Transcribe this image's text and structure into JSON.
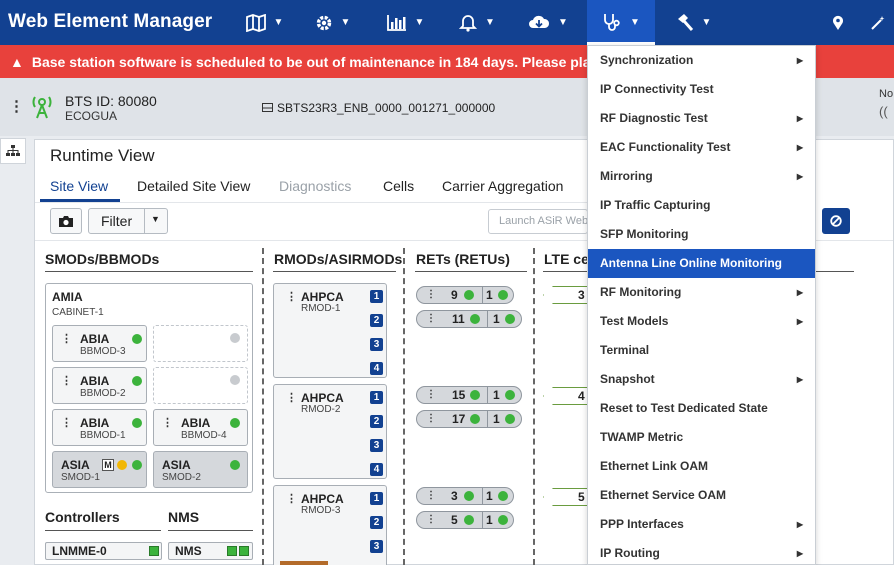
{
  "app": {
    "title": "Web Element Manager"
  },
  "nav": {
    "items": [
      {
        "icon": "map-icon"
      },
      {
        "icon": "gear-icon"
      },
      {
        "icon": "bar-chart-icon"
      },
      {
        "icon": "bell-icon"
      },
      {
        "icon": "cloud-download-icon"
      },
      {
        "icon": "stethoscope-icon"
      },
      {
        "icon": "hammer-icon"
      },
      {
        "icon": "location-pin-icon"
      },
      {
        "icon": "magic-wand-icon"
      }
    ]
  },
  "alert": {
    "text": "Base station software is scheduled to be out of maintenance in 184 days. Please plan to"
  },
  "bts": {
    "id": "BTS ID: 80080",
    "name": "ECOGUA",
    "software": "SBTS23R3_ENB_0000_001271_000000",
    "right_label": "No"
  },
  "runtime": {
    "title": "Runtime View",
    "tabs": [
      "Site View",
      "Detailed Site View",
      "Diagnostics",
      "Cells",
      "Carrier Aggregation"
    ],
    "filter_label": "Filter",
    "search_placeholder": "Launch ASiR Web"
  },
  "columns": {
    "smods": "SMODs/BBMODs",
    "rmods": "RMODs/ASIRMODs",
    "rets": "RETs (RETUs)",
    "lte": "LTE cel",
    "controllers": "Controllers",
    "nms": "NMS"
  },
  "amia": {
    "name": "AMIA",
    "sub": "CABINET-1"
  },
  "smods": [
    {
      "name": "ABIA",
      "sub": "BBMOD-3"
    },
    {
      "name": "ABIA",
      "sub": "BBMOD-2"
    },
    {
      "name": "ABIA",
      "sub": "BBMOD-1"
    },
    {
      "name": "ABIA",
      "sub": "BBMOD-4"
    },
    {
      "name": "ASIA",
      "sub": "SMOD-1",
      "badge": "M"
    },
    {
      "name": "ASIA",
      "sub": "SMOD-2"
    }
  ],
  "rmods": [
    {
      "name": "AHPCA",
      "sub": "RMOD-1",
      "ports": [
        "1",
        "2",
        "3",
        "4"
      ]
    },
    {
      "name": "AHPCA",
      "sub": "RMOD-2",
      "ports": [
        "1",
        "2",
        "3",
        "4"
      ]
    },
    {
      "name": "AHPCA",
      "sub": "RMOD-3",
      "ports": [
        "1",
        "2",
        "3"
      ]
    }
  ],
  "rets": [
    {
      "a": "9",
      "b": "1"
    },
    {
      "a": "11",
      "b": "1"
    },
    {
      "a": "15",
      "b": "1"
    },
    {
      "a": "17",
      "b": "1"
    },
    {
      "a": "3",
      "b": "1"
    },
    {
      "a": "5",
      "b": "1"
    }
  ],
  "cells": [
    "3",
    "4",
    "5"
  ],
  "controllers": {
    "lnmme": "LNMME-0",
    "nms": "NMS"
  },
  "menu": {
    "items": [
      {
        "label": "Synchronization",
        "submenu": true
      },
      {
        "label": "IP Connectivity Test",
        "submenu": false
      },
      {
        "label": "RF Diagnostic Test",
        "submenu": true
      },
      {
        "label": "EAC Functionality Test",
        "submenu": true
      },
      {
        "label": "Mirroring",
        "submenu": true
      },
      {
        "label": "IP Traffic Capturing",
        "submenu": false
      },
      {
        "label": "SFP Monitoring",
        "submenu": false
      },
      {
        "label": "Antenna Line Online Monitoring",
        "submenu": false,
        "selected": true
      },
      {
        "label": "RF Monitoring",
        "submenu": true
      },
      {
        "label": "Test Models",
        "submenu": true
      },
      {
        "label": "Terminal",
        "submenu": false
      },
      {
        "label": "Snapshot",
        "submenu": true
      },
      {
        "label": "Reset to Test Dedicated State",
        "submenu": false
      },
      {
        "label": "TWAMP Metric",
        "submenu": false
      },
      {
        "label": "Ethernet Link OAM",
        "submenu": false
      },
      {
        "label": "Ethernet Service OAM",
        "submenu": false
      },
      {
        "label": "PPP Interfaces",
        "submenu": true
      },
      {
        "label": "IP Routing",
        "submenu": true
      }
    ]
  },
  "colors": {
    "brand": "#124191",
    "active_nav": "#1b56c0",
    "alert": "#e8413c",
    "ok": "#3cb33c",
    "warn": "#f2b705"
  }
}
